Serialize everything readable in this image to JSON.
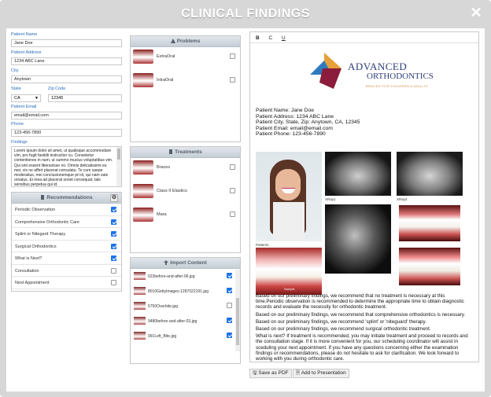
{
  "window": {
    "title": "CLINICAL FINDINGS"
  },
  "form": {
    "name_label": "Patient Name",
    "name_value": "Jane Doe",
    "address_label": "Patient Address",
    "address_value": "1234 ABC Lane",
    "city_label": "City",
    "city_value": "Anytown",
    "state_label": "State",
    "state_value": "CA",
    "zip_label": "Zip Code",
    "zip_value": "12345",
    "email_label": "Patient Email",
    "email_value": "email@email.com",
    "phone_label": "Phone",
    "phone_value": "123-456-7890",
    "findings_label": "Findings",
    "findings_text": "Lorem ipsum dolor sit amet, ut qualisque accommodare vim, pro fugit fastidii instructior cu. Consetetur contentiones in nam, ut summo mucius voluptatibus vim. Qui sint essent liberavisse no. Omnis delicatissimi eu mei, vix ne affert placerat consulatu. Te cum saepe moderatius, mei conclusionemque pri id, qui nam sale ornatus. Ei mea ad placerat sonet consequat, tale sensibus perpetua qui id."
  },
  "recommendations": {
    "title": "Recommendations",
    "items": [
      {
        "label": "Periodic Observation",
        "checked": true
      },
      {
        "label": "Comprehensive Orthodontic Care",
        "checked": true
      },
      {
        "label": "Splint or Nitegard Therapy",
        "checked": true
      },
      {
        "label": "Surgical Orthodontics",
        "checked": true
      },
      {
        "label": "What is Next?",
        "checked": true
      },
      {
        "label": "Consultation",
        "checked": false
      },
      {
        "label": "Next Appointment",
        "checked": false
      }
    ]
  },
  "problems": {
    "title": "Problems",
    "items": [
      {
        "label": "ExtraOral",
        "checked": false
      },
      {
        "label": "IntraOral",
        "checked": false
      }
    ]
  },
  "treatments": {
    "title": "Treatments",
    "items": [
      {
        "label": "Braces",
        "checked": false
      },
      {
        "label": "Class II Elastics",
        "checked": false
      },
      {
        "label": "Mara",
        "checked": false
      }
    ]
  },
  "import": {
    "title": "Import Content",
    "items": [
      {
        "label": "623before-and-after-06.jpg",
        "checked": true
      },
      {
        "label": "8010GettyImages-1287022191.jpg",
        "checked": true
      },
      {
        "label": "5750Overbite.jpg",
        "checked": false
      },
      {
        "label": "9480before-and-after-03.jpg",
        "checked": true
      },
      {
        "label": "991Left_Bite.jpg",
        "checked": true
      }
    ]
  },
  "editor": {
    "bold": "B",
    "code": "C",
    "underline": "U",
    "logo_line1": "ADVANCED",
    "logo_line2": "ORTHODONTICS",
    "logo_tagline": "BRACES FOR CHILDREN & ADULTS",
    "patient_name": "Patient Name: Jane Doe",
    "patient_address": "Patient Address: 1234 ABC Lane",
    "patient_city": "Patient City, State, Zip: Anytown, CA, 12345",
    "patient_email": "Patient Email: email@email.com",
    "patient_phone": "Patient Phone: 123-456-7890",
    "cap_patient1": "Patient1",
    "cap_xray1": "XRay1",
    "cap_xray2": "XRay2",
    "cap_sample": "Sample",
    "p1": "Based on our preliminary findings, we recommend that no treatment is necessary at this time.Periodic observation is recommended to determine the appropriate time to obtain diagnostic records and evaluate the necessity for orthodontic treatment.",
    "p2": "Based on our preliminary findings, we recommend that comprehensive orthodontics is necessary.",
    "p3": "Based on our preliminary findings, we recommend 'splint' or 'niteguard' therapy.",
    "p4": "Based on our preliminary findings, we recommend surgical orthodontic treatment.",
    "p5": "What is next? If treatment is recommended, you may initiate treatment and proceed to records and the consultation stage. If it is more convenient for you, our scheduling coordinator will assist in sceduling your next appointment. If you have any questions concerning either the examination findings or recommendations, please do not hesitate to ask for clarification. We look forward to working with you during orthodontic care."
  },
  "actions": {
    "save_pdf": "Save as PDF",
    "add_presentation": "Add to Presentation"
  }
}
